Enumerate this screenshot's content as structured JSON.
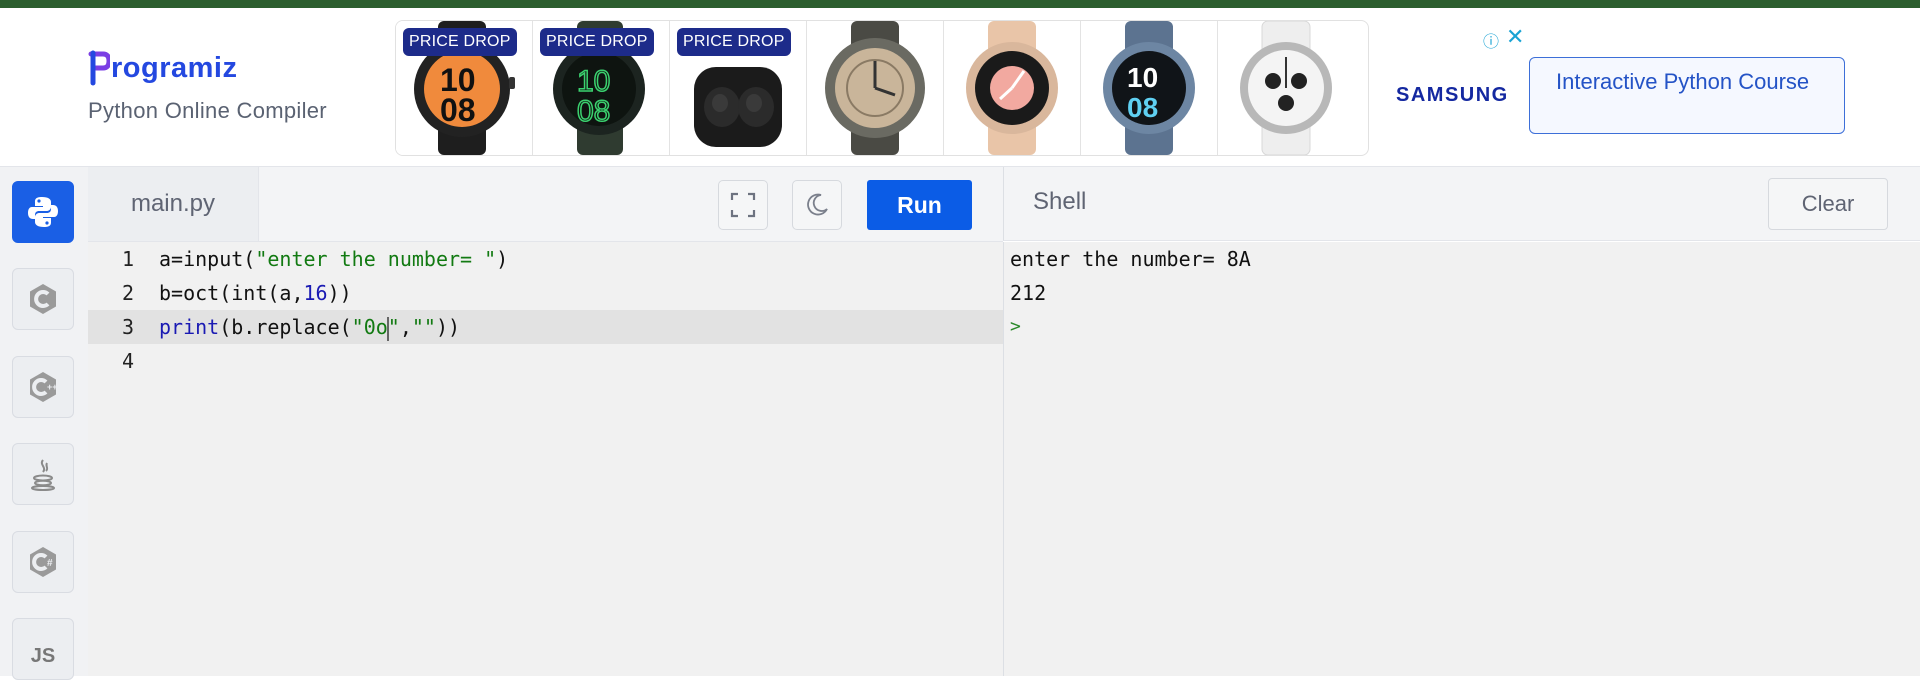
{
  "header": {
    "logo_text": "rogramiz",
    "subtitle": "Python Online Compiler",
    "ad": {
      "badges": [
        "PRICE DROP",
        "PRICE DROP",
        "PRICE DROP"
      ],
      "info_icon": "info-icon",
      "close_icon": "close-icon",
      "brand": "SAMSUNG",
      "cta": "Interactive Python Course",
      "tiles": [
        "watch-orange-face",
        "watch-green-face",
        "galaxy-buds-case",
        "watch-tan-face",
        "watch-pink-face",
        "watch-blue-face",
        "watch-white-face"
      ]
    }
  },
  "sidebar": {
    "items": [
      {
        "name": "python",
        "icon": "python-icon",
        "active": true
      },
      {
        "name": "c",
        "icon": "c-icon"
      },
      {
        "name": "cpp",
        "icon": "cpp-icon"
      },
      {
        "name": "java",
        "icon": "java-icon"
      },
      {
        "name": "csharp",
        "icon": "csharp-icon"
      },
      {
        "name": "js",
        "label": "JS"
      }
    ]
  },
  "editor": {
    "file_tab": "main.py",
    "fullscreen_icon": "fullscreen-icon",
    "theme_icon": "moon-icon",
    "run_label": "Run",
    "line_numbers": [
      "1",
      "2",
      "3",
      "4"
    ],
    "lines": [
      "a=input(\"enter the number= \")",
      "b=oct(int(a,16))",
      "print(b.replace(\"0o\",\"\"))",
      ""
    ],
    "active_line": 3
  },
  "shell": {
    "title": "Shell",
    "clear_label": "Clear",
    "output": [
      "enter the number= 8A",
      "212"
    ],
    "prompt": ">"
  },
  "colors": {
    "accent": "#0b5ce6",
    "topbar": "#2c5e2e",
    "string": "#127a12",
    "keyword": "#1a1ab3"
  }
}
